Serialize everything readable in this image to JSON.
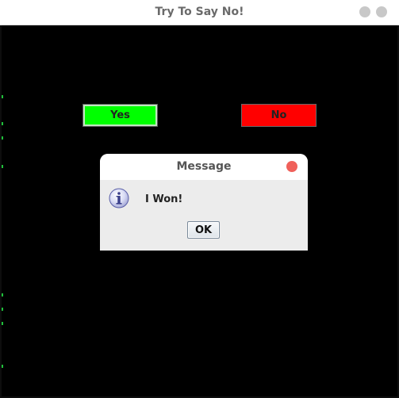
{
  "window": {
    "title": "Try To Say No!"
  },
  "buttons": {
    "yes_label": "Yes",
    "no_label": "No",
    "yes_color": "#00ff00",
    "no_color": "#ff0000"
  },
  "dialog": {
    "title": "Message",
    "icon": "info-icon",
    "message": "I Won!",
    "ok_label": "OK"
  }
}
